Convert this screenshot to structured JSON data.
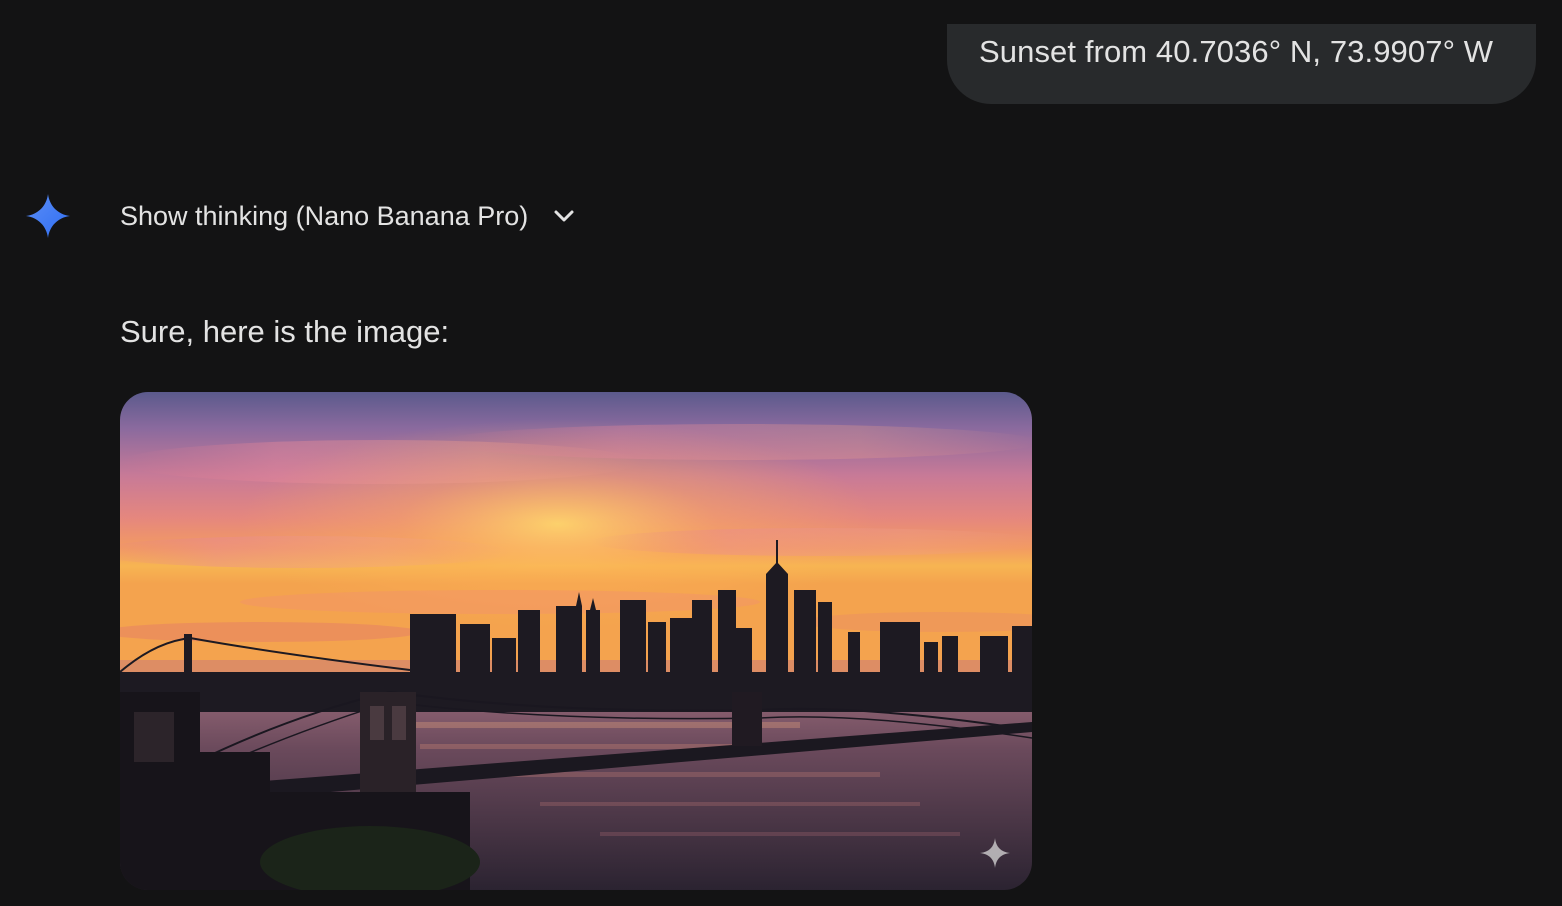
{
  "user_message": {
    "text": "Sunset from 40.7036° N, 73.9907° W"
  },
  "assistant": {
    "avatar_icon": "gemini-sparkle-icon",
    "thinking_toggle_label": "Show thinking (Nano Banana Pro)",
    "thinking_toggle_icon": "chevron-down-icon",
    "response_text": "Sure, here is the image:",
    "image": {
      "subject": "sunset-skyline-photo",
      "watermark_icon": "sparkle-icon"
    }
  },
  "colors": {
    "background": "#131314",
    "user_bubble": "#282a2c",
    "text": "#e3e3e3",
    "accent_blue": "#4285f4"
  }
}
